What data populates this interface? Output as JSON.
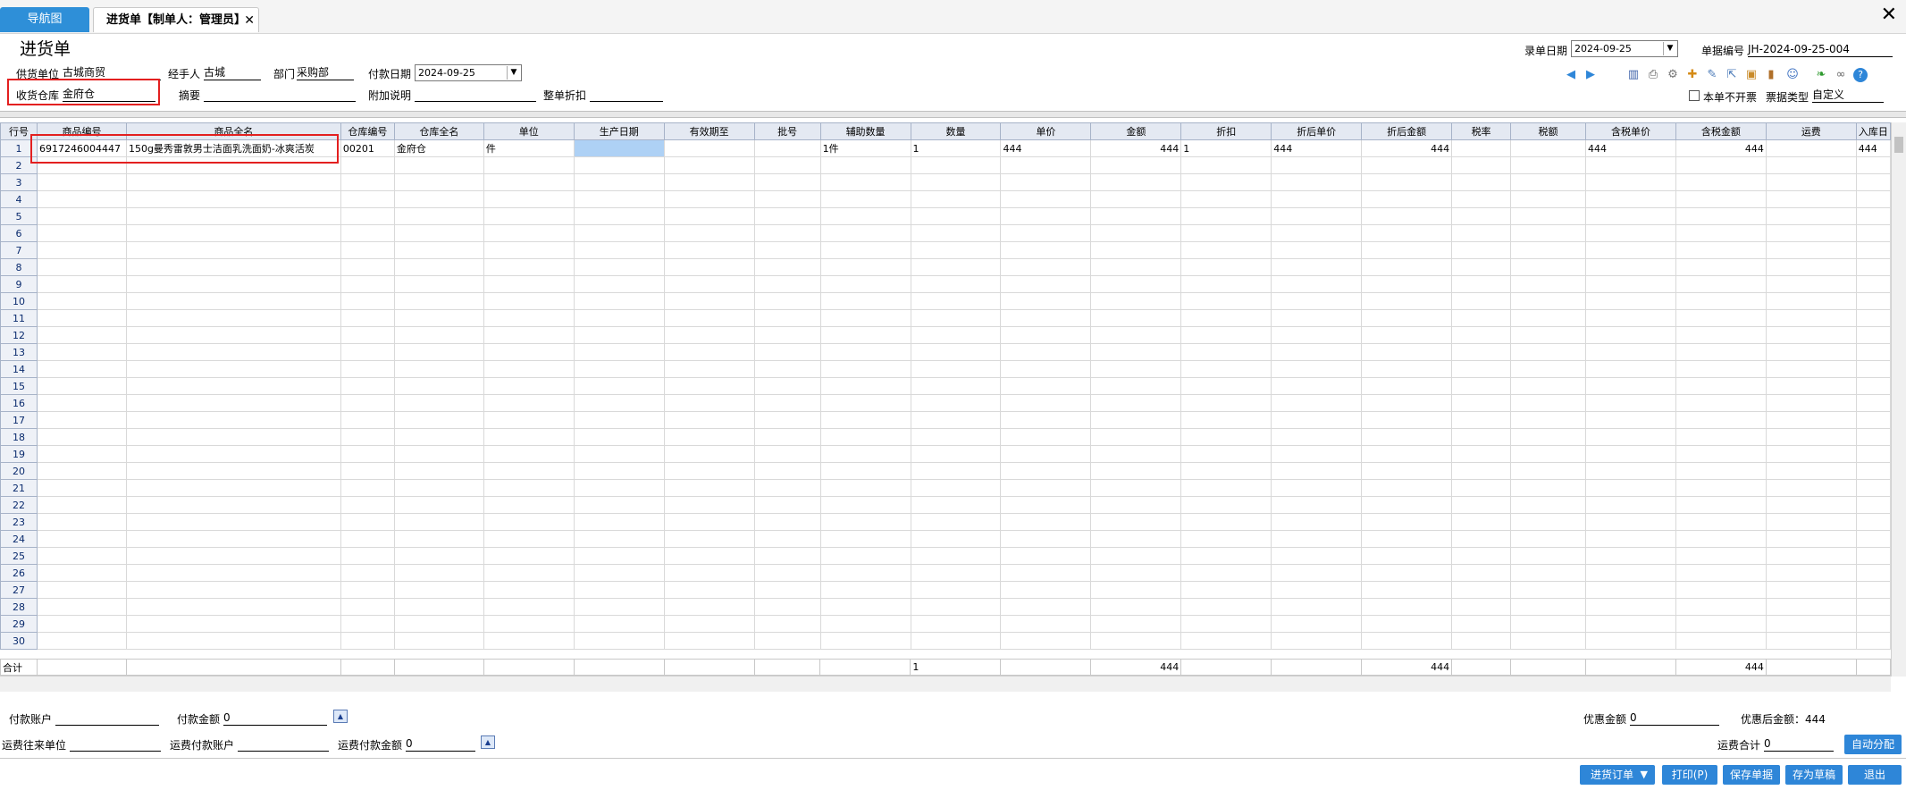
{
  "tabs": {
    "nav": "导航图",
    "active": "进货单【制单人：管理员】",
    "close": "✕"
  },
  "window": {
    "close": "✕"
  },
  "header": {
    "title": "进货单",
    "supplier_label": "供货单位",
    "supplier_value": "古城商贸",
    "handler_label": "经手人",
    "handler_value": "古城",
    "dept_label": "部门",
    "dept_value": "采购部",
    "pay_date_label": "付款日期",
    "pay_date_value": "2024-09-25",
    "warehouse_label": "收货仓库",
    "warehouse_value": "金府仓",
    "summary_label": "摘要",
    "summary_value": "",
    "note_label": "附加说明",
    "note_value": "",
    "discount_label": "整单折扣",
    "discount_value": "",
    "entry_date_label": "录单日期",
    "entry_date_value": "2024-09-25",
    "doc_no_label": "单据编号",
    "doc_no_value": "JH-2024-09-25-004",
    "no_invoice_label": "本单不开票",
    "invoice_type_label": "票据类型",
    "invoice_type_value": "自定义"
  },
  "grid": {
    "columns": [
      "行号",
      "商品编号",
      "商品全名",
      "仓库编号",
      "仓库全名",
      "单位",
      "生产日期",
      "有效期至",
      "批号",
      "辅助数量",
      "数量",
      "单价",
      "金额",
      "折扣",
      "折后单价",
      "折后金额",
      "税率",
      "税额",
      "含税单价",
      "含税金额",
      "运费",
      "入库日"
    ],
    "row1": {
      "no": "1",
      "code": "6917246004447",
      "name": "150g曼秀雷敦男士洁面乳洗面奶-冰爽活炭",
      "wh_code": "00201",
      "wh_name": "金府仓",
      "unit": "件",
      "aux_qty": "1件",
      "qty": "1",
      "price": "444",
      "amount": "444",
      "discount": "1",
      "disc_price": "444",
      "disc_amount": "444",
      "tax_price": "444",
      "tax_amount": "444",
      "in_day": "444"
    },
    "row_numbers": [
      "2",
      "3",
      "4",
      "5",
      "6",
      "7",
      "8",
      "9",
      "10",
      "11",
      "12",
      "13",
      "14",
      "15",
      "16",
      "17",
      "18",
      "19",
      "20",
      "21",
      "22",
      "23",
      "24",
      "25",
      "26",
      "27",
      "28",
      "29",
      "30"
    ],
    "total": {
      "label": "合计",
      "qty": "1",
      "amount": "444",
      "disc_amount": "444",
      "tax_amount": "444"
    }
  },
  "footer": {
    "pay_account_label": "付款账户",
    "pay_account_value": "",
    "pay_amount_label": "付款金额",
    "pay_amount_value": "0",
    "freight_unit_label": "运费往来单位",
    "freight_unit_value": "",
    "freight_account_label": "运费付款账户",
    "freight_account_value": "",
    "freight_amount_label": "运费付款金额",
    "freight_amount_value": "0",
    "discount_amount_label": "优惠金额",
    "discount_amount_value": "0",
    "after_discount_text": "优惠后金额：444",
    "freight_total_label": "运费合计",
    "freight_total_value": "0",
    "auto_allocate": "自动分配"
  },
  "buttons": {
    "purchase_order": "进货订单",
    "print": "打印(P)",
    "save": "保存单据",
    "draft": "存为草稿",
    "exit": "退出"
  },
  "colors": {
    "accent": "#2e86d8",
    "highlight": "#e32020",
    "selected_cell": "#aed1f5"
  }
}
